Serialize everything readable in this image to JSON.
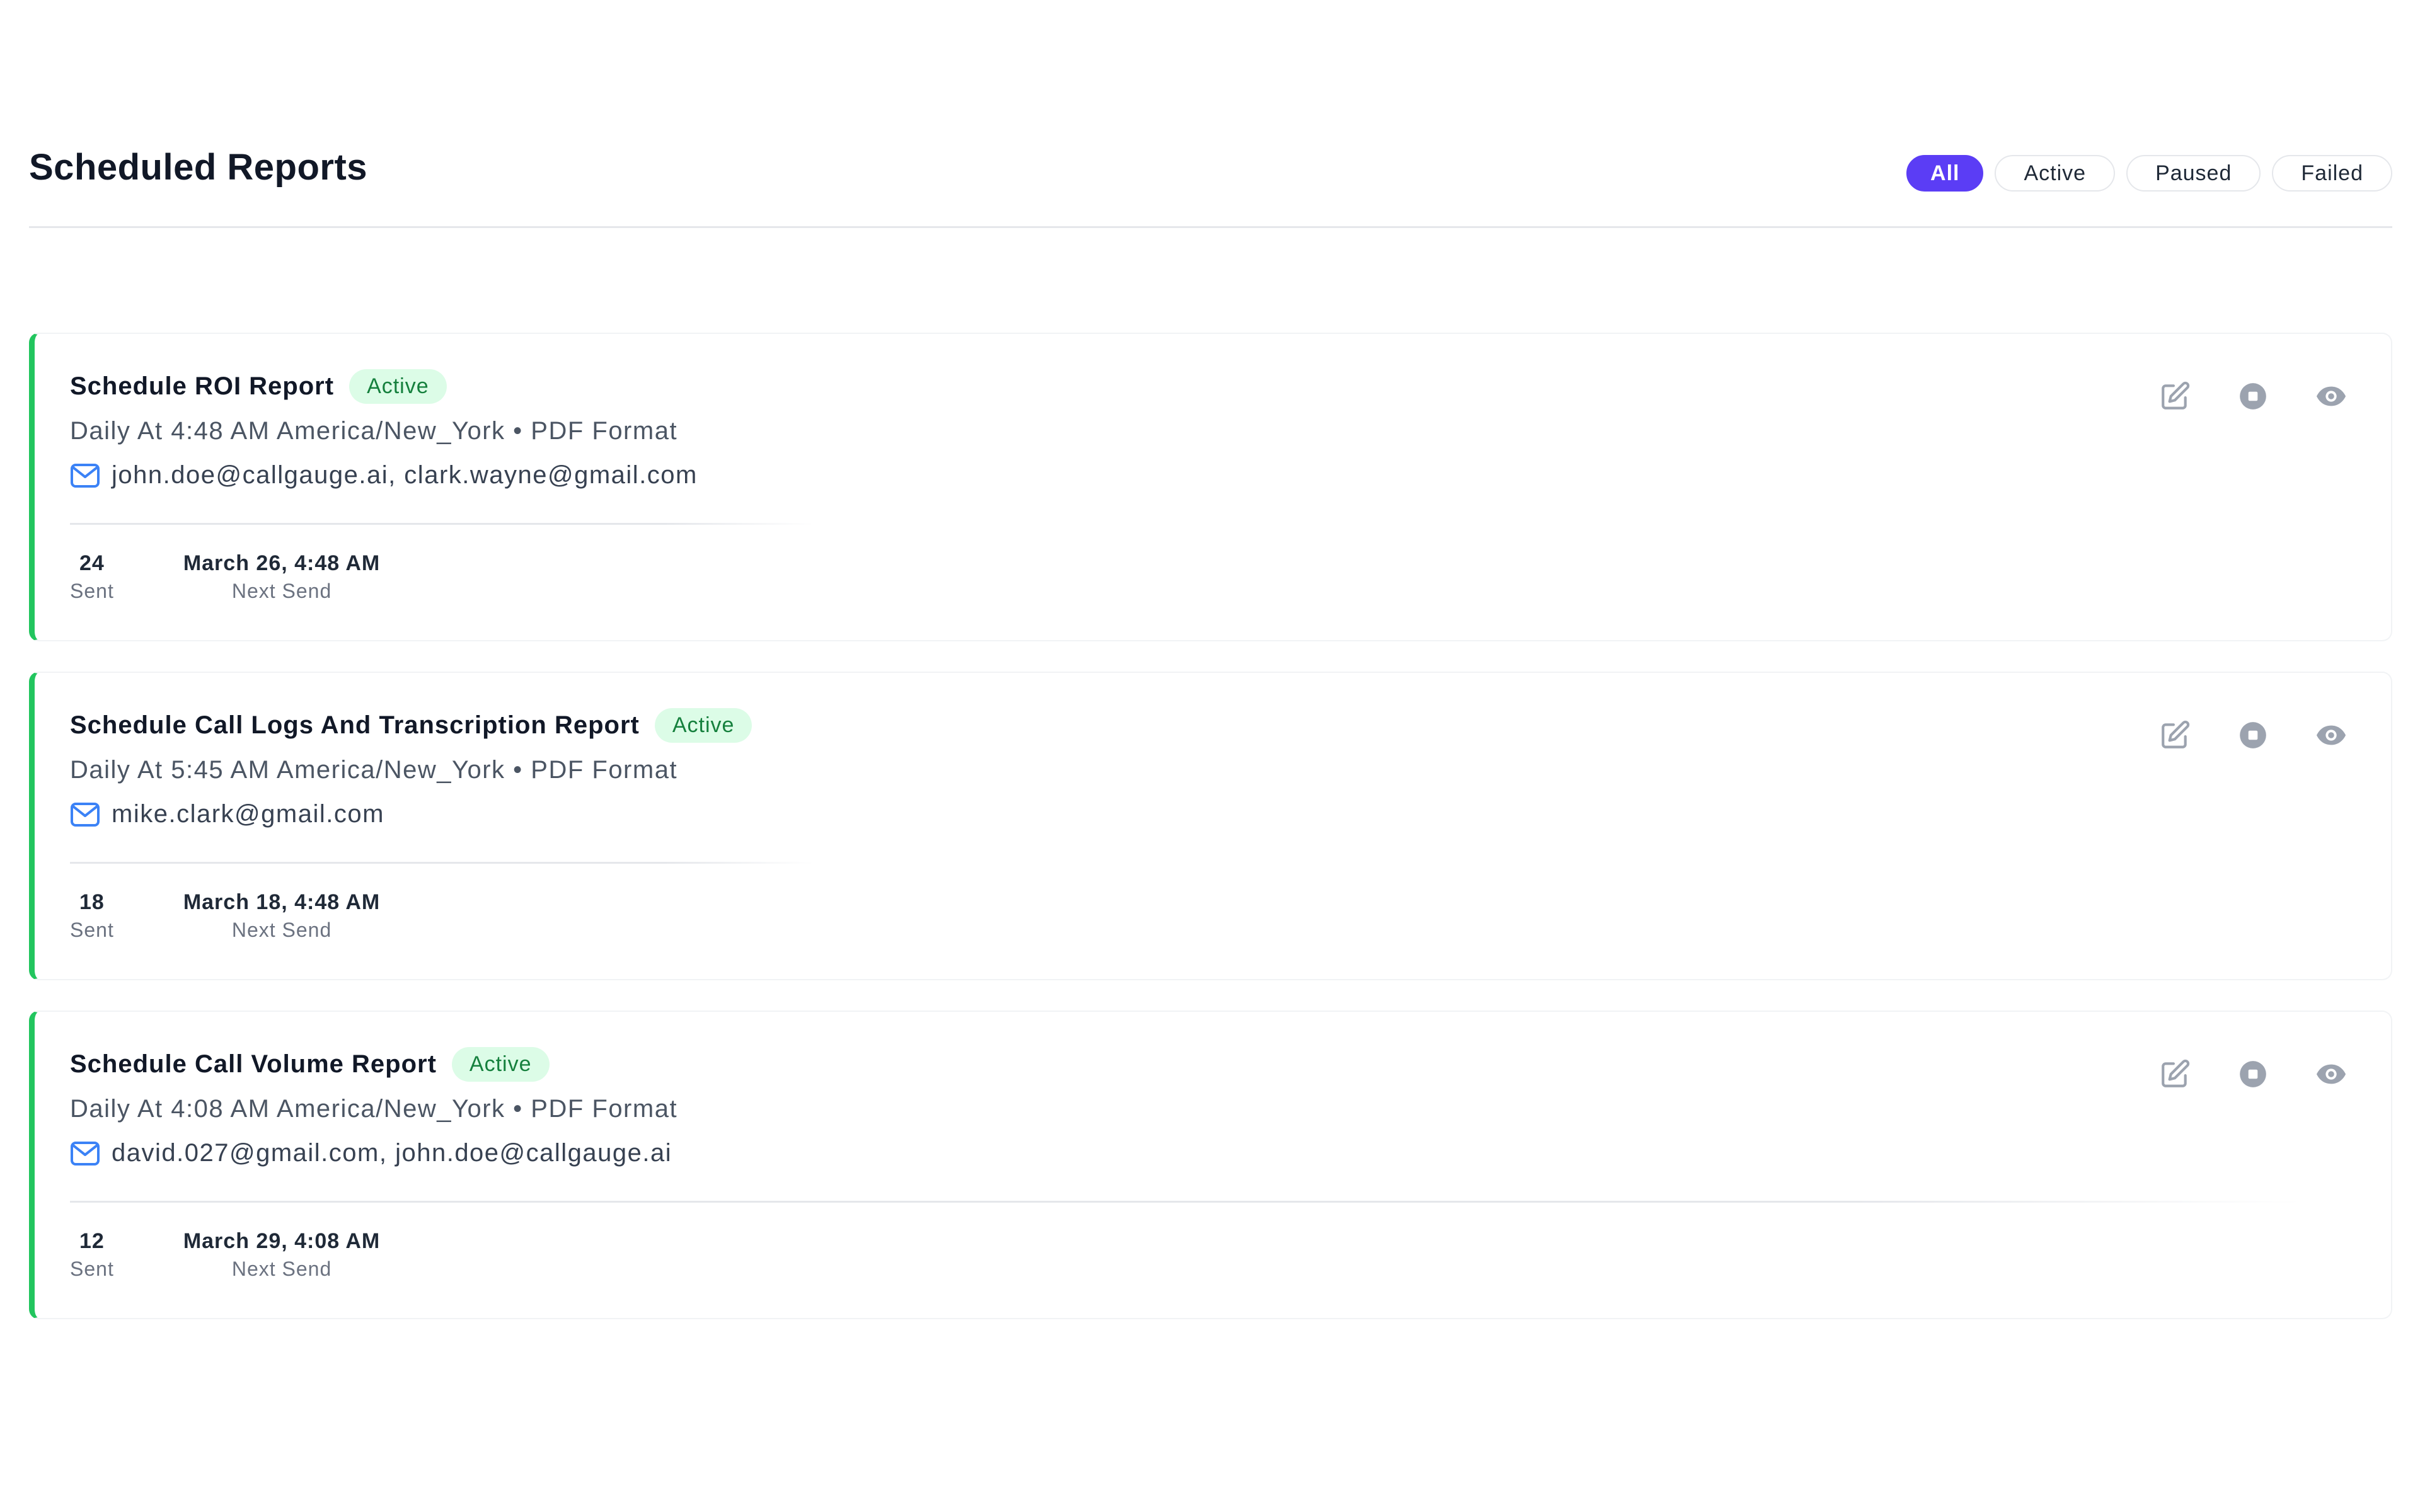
{
  "header": {
    "title": "Scheduled Reports"
  },
  "filters": [
    {
      "label": "All",
      "selected": true
    },
    {
      "label": "Active",
      "selected": false
    },
    {
      "label": "Paused",
      "selected": false
    },
    {
      "label": "Failed",
      "selected": false
    }
  ],
  "colors": {
    "accent": "#5b3df5",
    "active_border": "#22c55e",
    "badge_bg": "#dcfce7",
    "badge_text": "#15803d",
    "mail_icon": "#3b82f6",
    "action_icon": "#9ca3af"
  },
  "reports": [
    {
      "title": "Schedule ROI Report",
      "status": "Active",
      "schedule": "Daily At 4:48 AM America/New_York • PDF Format",
      "recipients": "john.doe@callgauge.ai, clark.wayne@gmail.com",
      "sent_count": "24",
      "sent_label": "Sent",
      "next_send": "March 26, 4:48 AM",
      "next_send_label": "Next Send"
    },
    {
      "title": "Schedule Call Logs And Transcription Report",
      "status": "Active",
      "schedule": "Daily At 5:45 AM America/New_York • PDF Format",
      "recipients": "mike.clark@gmail.com",
      "sent_count": "18",
      "sent_label": "Sent",
      "next_send": "March 18, 4:48 AM",
      "next_send_label": "Next Send"
    },
    {
      "title": "Schedule Call Volume Report",
      "status": "Active",
      "schedule": "Daily At 4:08 AM America/New_York • PDF Format",
      "recipients": "david.027@gmail.com, john.doe@callgauge.ai",
      "sent_count": "12",
      "sent_label": "Sent",
      "next_send": "March 29, 4:08 AM",
      "next_send_label": "Next Send"
    }
  ],
  "icons": {
    "edit": "edit-icon",
    "stop": "stop-icon",
    "view": "eye-icon",
    "mail": "mail-icon"
  }
}
